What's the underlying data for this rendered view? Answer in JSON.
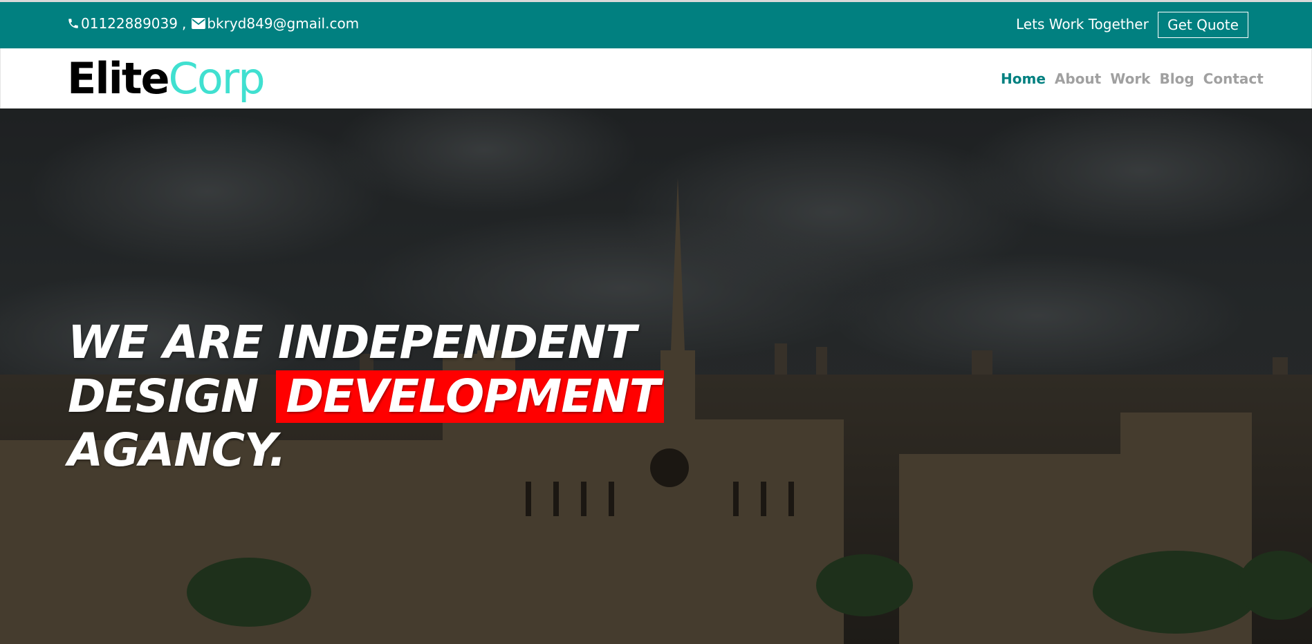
{
  "topbar": {
    "phone": "01122889039",
    "separator": ",",
    "email": "bkryd849@gmail.com",
    "work_together": "Lets Work Together",
    "quote_button": "Get Quote",
    "phone_icon": "phone-icon",
    "email_icon": "envelope-icon",
    "bg_color": "#018080"
  },
  "brand": {
    "part1": "Elite",
    "part2": "Corp",
    "part1_color": "#000000",
    "part2_color": "#40e0d0"
  },
  "nav": {
    "items": [
      {
        "label": "Home",
        "active": true
      },
      {
        "label": "About",
        "active": false
      },
      {
        "label": "Work",
        "active": false
      },
      {
        "label": "Blog",
        "active": false
      },
      {
        "label": "Contact",
        "active": false
      }
    ],
    "active_color": "#018080",
    "inactive_color": "#a0a0a0"
  },
  "hero": {
    "line1": "WE ARE INDEPENDENT",
    "line2_prefix": "DESIGN",
    "line2_highlight": "DEVELOPMENT",
    "line3": "AGANCY.",
    "highlight_color": "#ff0000",
    "background_image": "city-skyline-photo"
  }
}
